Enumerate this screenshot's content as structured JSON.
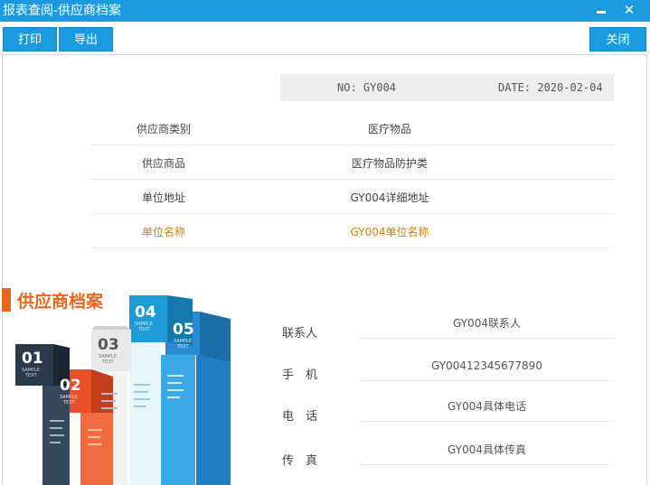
{
  "window": {
    "title": "报表查阅-供应商档案"
  },
  "toolbar": {
    "print_label": "打印",
    "export_label": "导出",
    "close_label": "关闭"
  },
  "header": {
    "no_text": "NO: GY004",
    "date_text": "DATE: 2020-02-04"
  },
  "info": [
    {
      "label": "供应商类别",
      "value": "医疗物品"
    },
    {
      "label": "供应商品",
      "value": "医疗物品防护类"
    },
    {
      "label": "单位地址",
      "value": "GY004详细地址"
    },
    {
      "label": "单位名称",
      "value": "GY004单位名称"
    }
  ],
  "section": {
    "title": "供应商档案"
  },
  "contact": [
    {
      "label": "联系人",
      "value": "GY004联系人"
    },
    {
      "label": "手　机",
      "value": "GY00412345677890"
    },
    {
      "label": "电　话",
      "value": "GY004具体电话"
    },
    {
      "label": "传　真",
      "value": "GY004具体传真"
    }
  ],
  "infographic": {
    "blocks": [
      {
        "num": "01",
        "sub1": "SAMPLE",
        "sub2": "TEXT",
        "color": "#2b3a4a"
      },
      {
        "num": "02",
        "sub1": "SAMPLE",
        "sub2": "TEXT",
        "color": "#e8502a"
      },
      {
        "num": "03",
        "sub1": "SAMPLE",
        "sub2": "TEXT",
        "color": "#e9e9e9"
      },
      {
        "num": "04",
        "sub1": "SAMPLE",
        "sub2": "TEXT",
        "color": "#1e9ad6"
      },
      {
        "num": "05",
        "sub1": "SAMPLE",
        "sub2": "TEXT",
        "color": "#1e7fc4"
      }
    ]
  },
  "colors": {
    "accent": "#1a9be0",
    "highlight": "#e07b00",
    "section": "#e8671e"
  }
}
